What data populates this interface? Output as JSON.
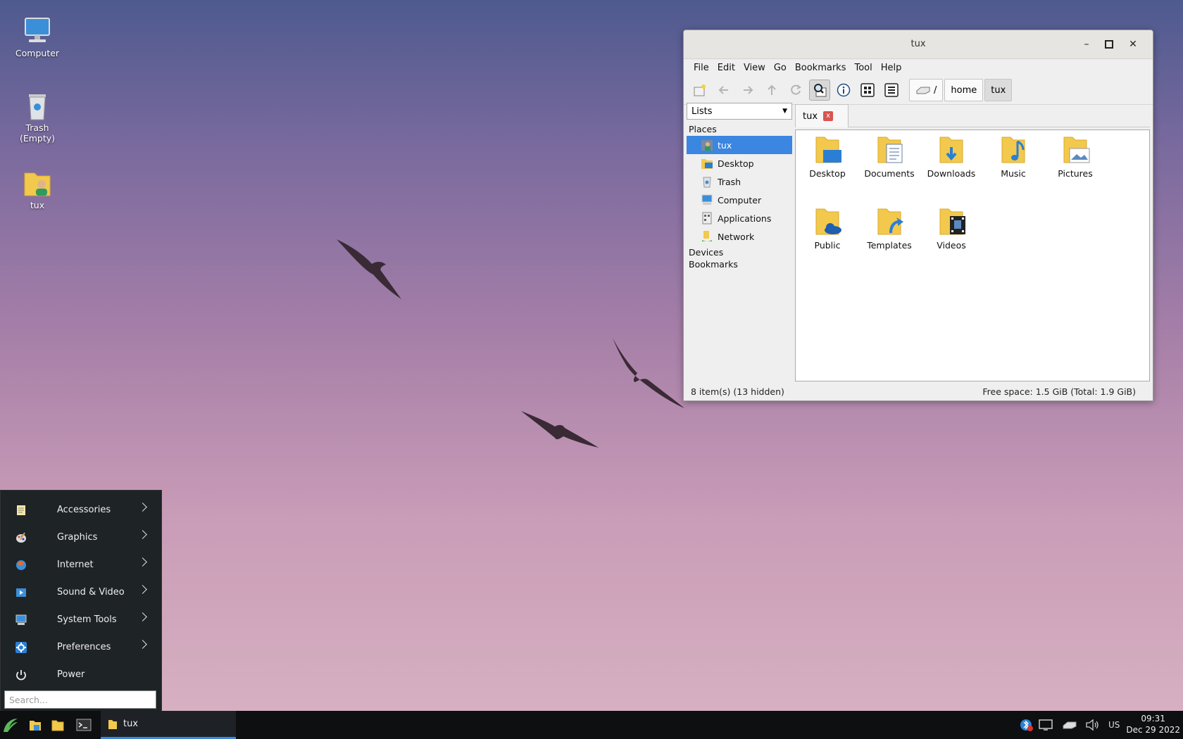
{
  "desktop": {
    "icons": [
      {
        "label": "Computer"
      },
      {
        "label": "Trash\n(Empty)"
      },
      {
        "label": "tux"
      }
    ]
  },
  "window": {
    "title": "tux",
    "menu": [
      "File",
      "Edit",
      "View",
      "Go",
      "Bookmarks",
      "Tool",
      "Help"
    ],
    "breadcrumbs": [
      "/",
      "home",
      "tux"
    ],
    "side_combo": "Lists",
    "sections": {
      "places": "Places",
      "devices": "Devices",
      "bookmarks": "Bookmarks"
    },
    "places": [
      {
        "label": "tux",
        "icon": "home-folder-icon",
        "selected": true
      },
      {
        "label": "Desktop",
        "icon": "desktop-icon"
      },
      {
        "label": "Trash",
        "icon": "trash-icon"
      },
      {
        "label": "Computer",
        "icon": "computer-icon"
      },
      {
        "label": "Applications",
        "icon": "applications-icon"
      },
      {
        "label": "Network",
        "icon": "network-icon"
      }
    ],
    "tab": {
      "label": "tux",
      "close": "x"
    },
    "files": [
      {
        "label": "Desktop",
        "icon": "folder-desktop-icon"
      },
      {
        "label": "Documents",
        "icon": "folder-documents-icon"
      },
      {
        "label": "Downloads",
        "icon": "folder-downloads-icon"
      },
      {
        "label": "Music",
        "icon": "folder-music-icon"
      },
      {
        "label": "Pictures",
        "icon": "folder-pictures-icon"
      },
      {
        "label": "Public",
        "icon": "folder-public-icon"
      },
      {
        "label": "Templates",
        "icon": "folder-templates-icon"
      },
      {
        "label": "Videos",
        "icon": "folder-videos-icon"
      }
    ],
    "status_left": "8 item(s) (13 hidden)",
    "status_right": "Free space: 1.5 GiB (Total: 1.9 GiB)"
  },
  "start_menu": {
    "items": [
      {
        "label": "Accessories",
        "submenu": true
      },
      {
        "label": "Graphics",
        "submenu": true
      },
      {
        "label": "Internet",
        "submenu": true
      },
      {
        "label": "Sound & Video",
        "submenu": true
      },
      {
        "label": "System Tools",
        "submenu": true
      },
      {
        "label": "Preferences",
        "submenu": true
      },
      {
        "label": "Power",
        "submenu": false
      }
    ],
    "search_placeholder": "Search..."
  },
  "taskbar": {
    "window_label": "tux",
    "keyboard_layout": "US",
    "time": "09:31",
    "date": "Dec 29 2022"
  },
  "colors": {
    "selection": "#3a86e0",
    "folder": "#f2c94c",
    "menu_bg": "#1e2326"
  }
}
